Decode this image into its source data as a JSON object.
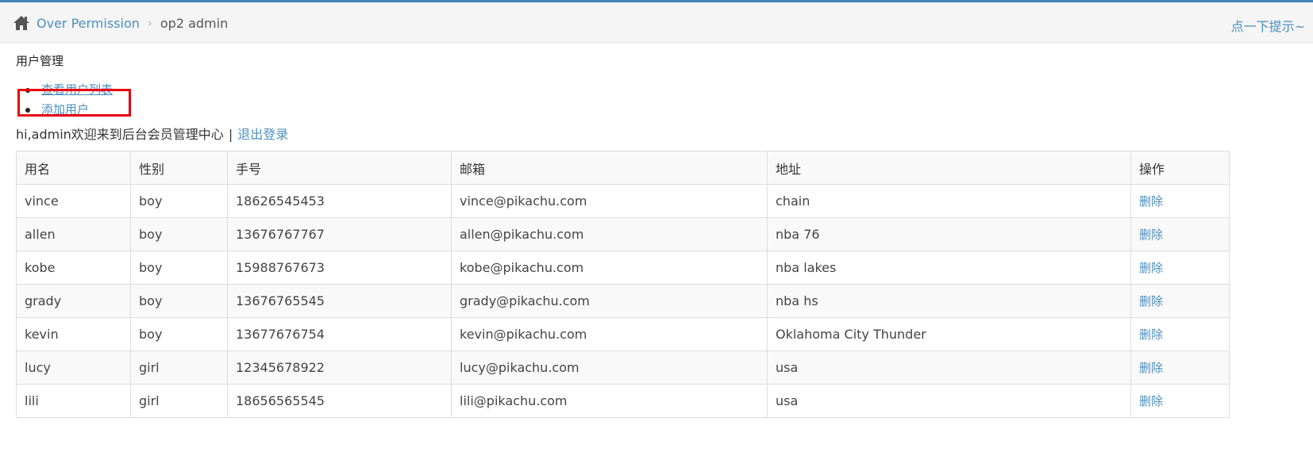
{
  "header": {
    "breadcrumb_home": "Over Permission",
    "breadcrumb_sep": "›",
    "breadcrumb_current": "op2 admin",
    "tip": "点一下提示~",
    "accent_color": "#4383b4"
  },
  "section": {
    "title": "用户管理",
    "menu": [
      {
        "label": "查看用户列表"
      },
      {
        "label": "添加用户"
      }
    ]
  },
  "welcome": {
    "text": "hi,admin欢迎来到后台会员管理中心",
    "separator": "|",
    "logout": "退出登录"
  },
  "table": {
    "headers": [
      "用名",
      "性别",
      "手号",
      "邮箱",
      "地址",
      "操作"
    ],
    "rows": [
      {
        "name": "vince",
        "sex": "boy",
        "phone": "18626545453",
        "email": "vince@pikachu.com",
        "address": "chain",
        "action": "删除"
      },
      {
        "name": "allen",
        "sex": "boy",
        "phone": "13676767767",
        "email": "allen@pikachu.com",
        "address": "nba 76",
        "action": "删除"
      },
      {
        "name": "kobe",
        "sex": "boy",
        "phone": "15988767673",
        "email": "kobe@pikachu.com",
        "address": "nba lakes",
        "action": "删除"
      },
      {
        "name": "grady",
        "sex": "boy",
        "phone": "13676765545",
        "email": "grady@pikachu.com",
        "address": "nba hs",
        "action": "删除"
      },
      {
        "name": "kevin",
        "sex": "boy",
        "phone": "13677676754",
        "email": "kevin@pikachu.com",
        "address": "Oklahoma City Thunder",
        "action": "删除"
      },
      {
        "name": "lucy",
        "sex": "girl",
        "phone": "12345678922",
        "email": "lucy@pikachu.com",
        "address": "usa",
        "action": "删除"
      },
      {
        "name": "lili",
        "sex": "girl",
        "phone": "18656565545",
        "email": "lili@pikachu.com",
        "address": "usa",
        "action": "删除"
      }
    ]
  }
}
